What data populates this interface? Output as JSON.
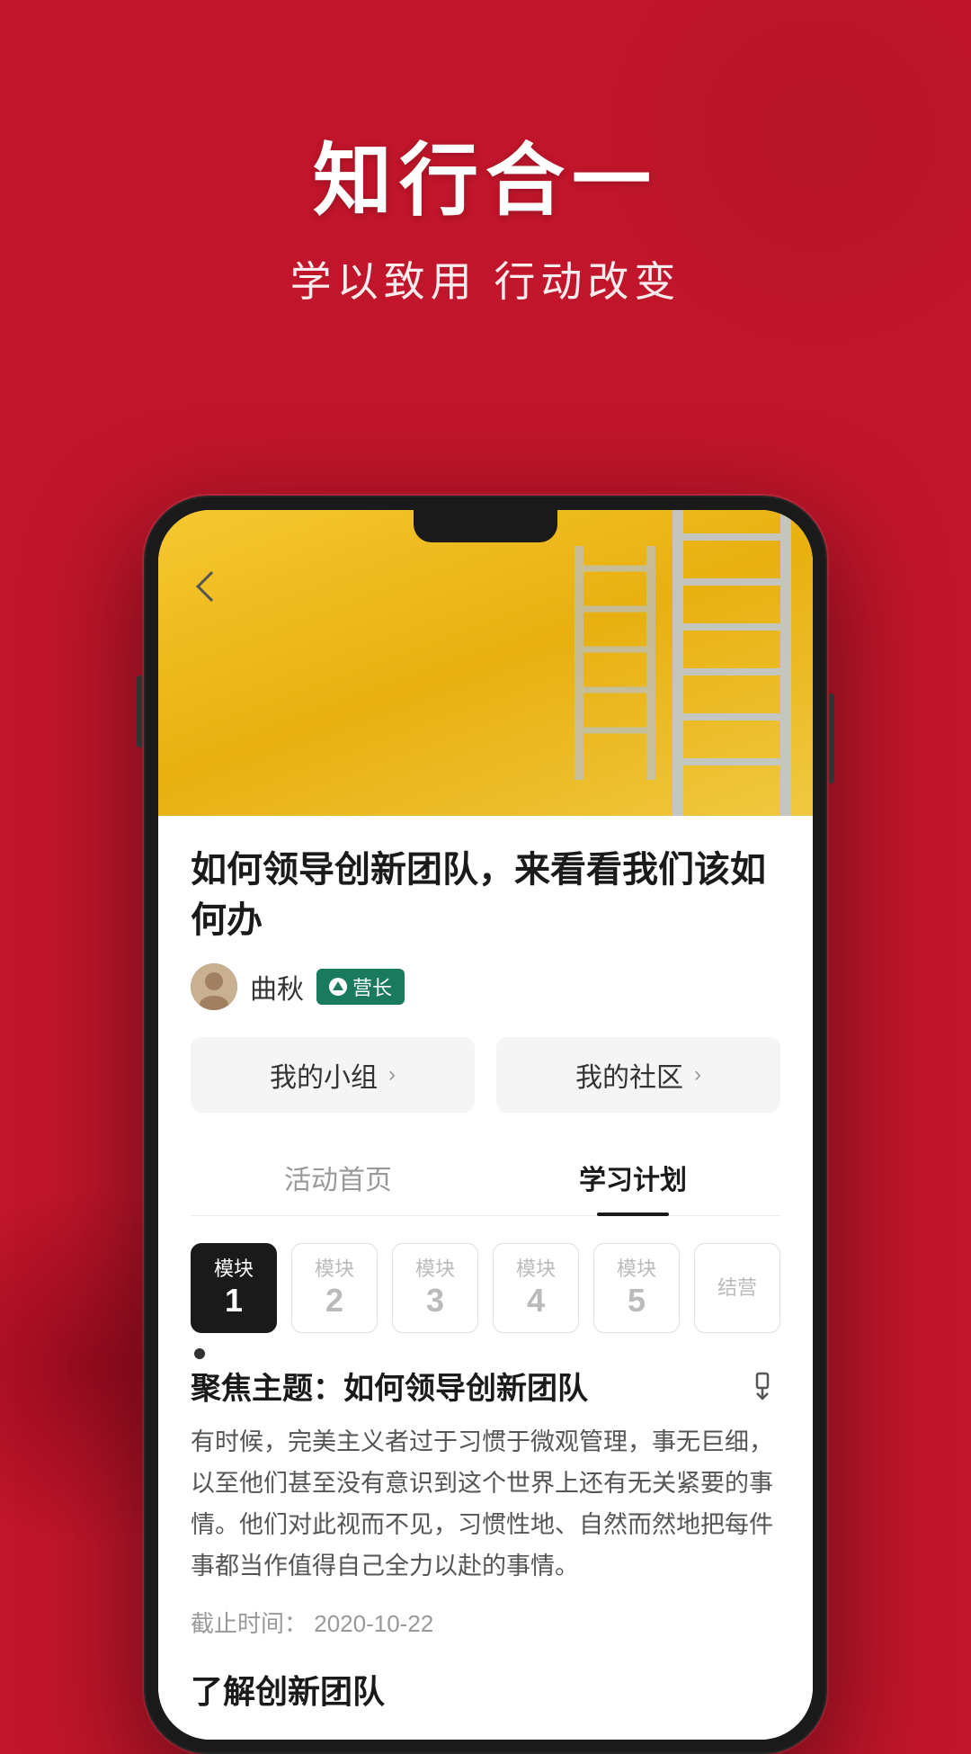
{
  "header": {
    "title": "知行合一",
    "subtitle": "学以致用 行动改变"
  },
  "phone": {
    "hero_alt": "Yellow background with ladders"
  },
  "article": {
    "title": "如何领导创新团队，来看看我们该如何办",
    "author_name": "曲秋",
    "badge_label": "营长",
    "back_label": "返回"
  },
  "nav_buttons": [
    {
      "label": "我的小组",
      "chevron": "›"
    },
    {
      "label": "我的社区",
      "chevron": "›"
    }
  ],
  "tabs": [
    {
      "label": "活动首页",
      "active": false
    },
    {
      "label": "学习计划",
      "active": true
    }
  ],
  "modules": [
    {
      "label": "模块",
      "number": "1",
      "active": true
    },
    {
      "label": "模块",
      "number": "2",
      "active": false
    },
    {
      "label": "模块",
      "number": "3",
      "active": false
    },
    {
      "label": "模块",
      "number": "4",
      "active": false
    },
    {
      "label": "模块",
      "number": "5",
      "active": false
    },
    {
      "label": "结营",
      "number": "",
      "active": false
    }
  ],
  "focus": {
    "section_label": "聚焦主题：",
    "section_title": "如何领导创新团队",
    "body": "有时候，完美主义者过于习惯于微观管理，事无巨细，以至他们甚至没有意识到这个世界上还有无关紧要的事情。他们对此视而不见，习惯性地、自然而然地把每件事都当作值得自己全力以赴的事情。",
    "deadline_label": "截止时间：",
    "deadline_value": "2020-10-22",
    "understand_title": "了解创新团队"
  }
}
